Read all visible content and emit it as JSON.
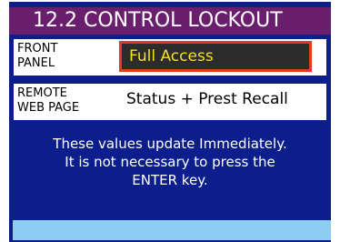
{
  "title": "12.2  CONTROL LOCKOUT",
  "settings": [
    {
      "label_line1": "FRONT",
      "label_line2": "PANEL",
      "value": "Full Access",
      "selected": true
    },
    {
      "label_line1": "REMOTE",
      "label_line2": "WEB PAGE",
      "value": "Status + Prest Recall",
      "selected": false
    }
  ],
  "info": {
    "line1": "These values update Immediately.",
    "line2": "It is not necessary to press the",
    "line3": "ENTER key."
  },
  "colors": {
    "background": "#0b1e8c",
    "title_bar": "#6a1f6e",
    "selected_border": "#e23b1f",
    "selected_text": "#f4e21a",
    "selected_fill": "#2c2c2c",
    "footer_bar": "#8ecdf2"
  }
}
